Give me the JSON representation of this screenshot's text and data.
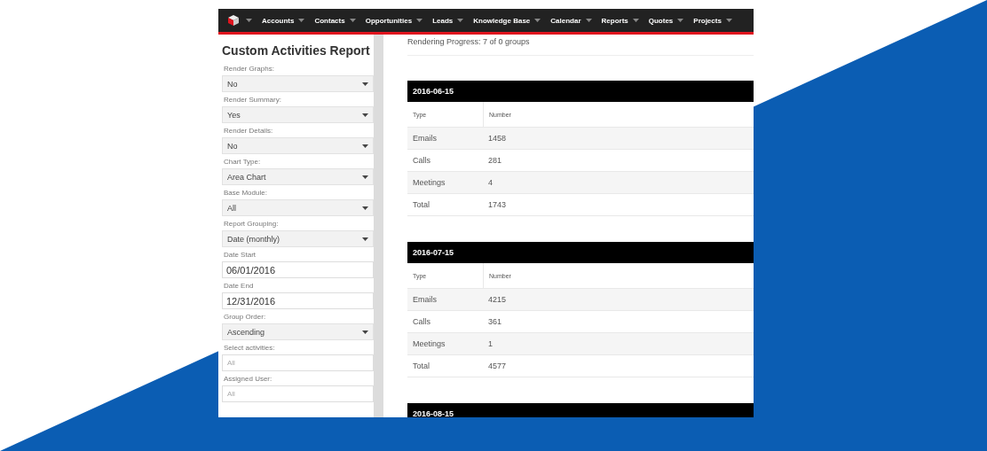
{
  "nav": {
    "items": [
      "Accounts",
      "Contacts",
      "Opportunities",
      "Leads",
      "Knowledge Base",
      "Calendar",
      "Reports",
      "Quotes",
      "Projects"
    ]
  },
  "sidebar": {
    "title": "Custom Activities Report",
    "fields": [
      {
        "kind": "select",
        "label": "Render Graphs:",
        "value": "No"
      },
      {
        "kind": "select",
        "label": "Render Summary:",
        "value": "Yes"
      },
      {
        "kind": "select",
        "label": "Render Details:",
        "value": "No"
      },
      {
        "kind": "select",
        "label": "Chart Type:",
        "value": "Area Chart"
      },
      {
        "kind": "select",
        "label": "Base Module:",
        "value": "All"
      },
      {
        "kind": "select",
        "label": "Report Grouping:",
        "value": "Date (monthly)"
      },
      {
        "kind": "date",
        "label": "Date Start",
        "value": "06/01/2016"
      },
      {
        "kind": "date",
        "label": "Date End",
        "value": "12/31/2016"
      },
      {
        "kind": "select",
        "label": "Group Order:",
        "value": "Ascending"
      },
      {
        "kind": "multiselect",
        "label": "Select activities:",
        "placeholder": "All"
      },
      {
        "kind": "multiselect",
        "label": "Assigned User:",
        "placeholder": "All"
      }
    ]
  },
  "content": {
    "progress": "Rendering Progress: 7 of 0 groups",
    "groups": [
      {
        "date": "2016-06-15",
        "columns": [
          "Type",
          "Number"
        ],
        "rows": [
          {
            "type": "Emails",
            "number": "1458"
          },
          {
            "type": "Calls",
            "number": "281"
          },
          {
            "type": "Meetings",
            "number": "4"
          },
          {
            "type": "Total",
            "number": "1743"
          }
        ]
      },
      {
        "date": "2016-07-15",
        "columns": [
          "Type",
          "Number"
        ],
        "rows": [
          {
            "type": "Emails",
            "number": "4215"
          },
          {
            "type": "Calls",
            "number": "361"
          },
          {
            "type": "Meetings",
            "number": "1"
          },
          {
            "type": "Total",
            "number": "4577"
          }
        ]
      },
      {
        "date": "2016-08-15"
      }
    ]
  }
}
